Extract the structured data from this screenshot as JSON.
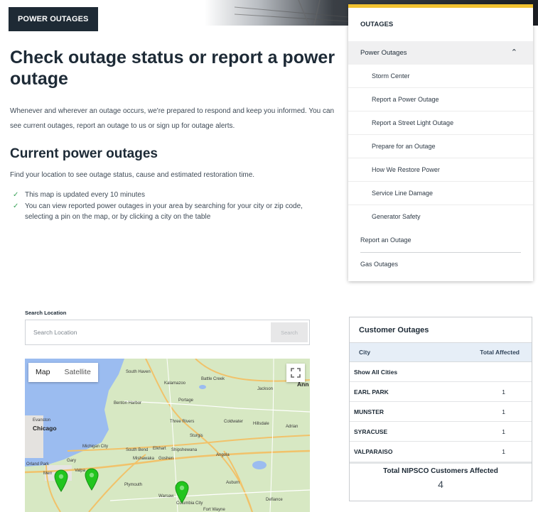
{
  "header": {
    "badge": "POWER OUTAGES"
  },
  "main": {
    "title": "Check outage status or report a power outage",
    "intro": "Whenever and wherever an outage occurs, we're prepared to respond and keep you informed. You can see current outages, report an outage to us or sign up for outage alerts.",
    "section_title": "Current power outages",
    "find_text": "Find your location to see outage status, cause and estimated restoration time.",
    "bullets": [
      "This map is updated every 10 minutes",
      "You can view reported power outages in your area by searching for your city or zip code, selecting a pin on the map, or by clicking a city on the table"
    ]
  },
  "sidebar": {
    "heading": "OUTAGES",
    "group_label": "Power Outages",
    "sub_items": [
      "Storm Center",
      "Report a Power Outage",
      "Report a Street Light Outage",
      "Prepare for an Outage",
      "How We Restore Power",
      "Service Line Damage",
      "Generator Safety"
    ],
    "top_items": [
      "Report an Outage",
      "Gas Outages"
    ]
  },
  "search": {
    "label": "Search Location",
    "placeholder": "Search Location",
    "button": "Search"
  },
  "map": {
    "toggle_map": "Map",
    "toggle_satellite": "Satellite",
    "labels": {
      "chicago": "Chicago",
      "evanston": "Evanston",
      "south_haven": "South Haven",
      "kalamazoo": "Kalamazoo",
      "battle_creek": "Battle Creek",
      "jackson": "Jackson",
      "ann": "Ann",
      "benton_harbor": "Benton Harbor",
      "portage": "Portage",
      "three_rivers": "Three Rivers",
      "coldwater": "Coldwater",
      "hillsdale": "Hillsdale",
      "adrian": "Adrian",
      "sturgis": "Sturgis",
      "michigan_city": "Michigan City",
      "south_bend": "South Bend",
      "elkhart": "Elkhart",
      "shipshewana": "Shipshewana",
      "mishawaka": "Mishawaka",
      "goshen": "Goshen",
      "angola": "Angola",
      "gary": "Gary",
      "orland_park": "Orland Park",
      "valpo": "Valpa",
      "plymouth": "Plymouth",
      "auburn": "Auburn",
      "warsaw": "Warsaw",
      "defiance": "Defiance",
      "columbia_city": "Columbia City",
      "fort_wayne": "Fort Wayne",
      "merr": "Merr"
    },
    "pin_color": "#22c51e",
    "water_color": "#9bbcf0",
    "land_color": "#d7e8c3"
  },
  "outages_panel": {
    "title": "Customer Outages",
    "col_city": "City",
    "col_total": "Total Affected",
    "show_all": "Show All Cities",
    "rows": [
      {
        "city": "EARL PARK",
        "count": "1"
      },
      {
        "city": "MUNSTER",
        "count": "1"
      },
      {
        "city": "SYRACUSE",
        "count": "1"
      },
      {
        "city": "VALPARAISO",
        "count": "1"
      }
    ],
    "total_label": "Total NIPSCO Customers Affected",
    "total_value": "4"
  },
  "colors": {
    "navy": "#1e2a35",
    "accent": "#f2c230",
    "check": "#3aa35a"
  }
}
